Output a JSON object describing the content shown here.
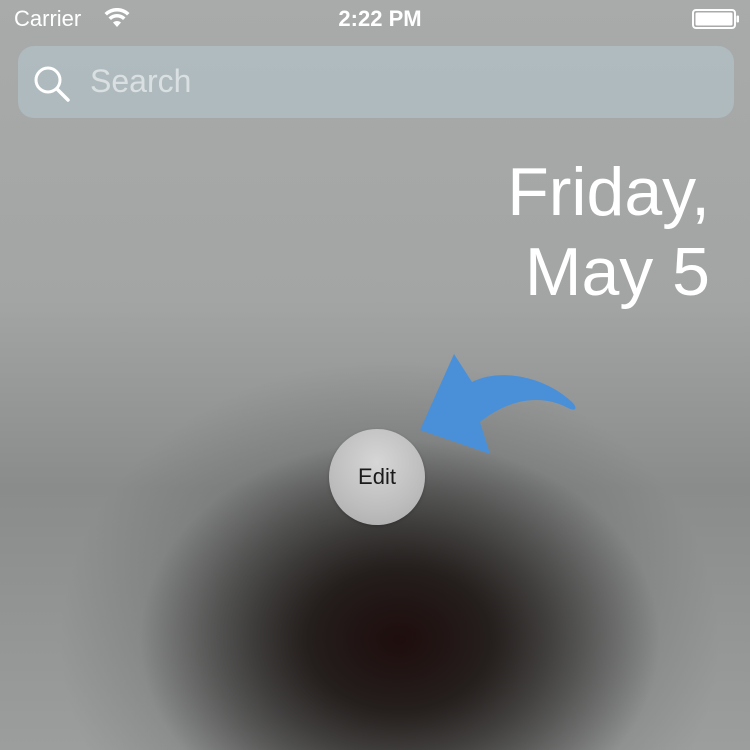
{
  "status_bar": {
    "carrier": "Carrier",
    "time": "2:22 PM",
    "wifi_icon": "wifi-icon",
    "battery_icon": "battery-icon"
  },
  "search": {
    "placeholder": "Search",
    "icon": "search-icon"
  },
  "date": {
    "line1": "Friday,",
    "line2": "May 5"
  },
  "edit_button": {
    "label": "Edit"
  },
  "annotation": {
    "icon": "arrow-icon",
    "color": "#4a90d9"
  }
}
